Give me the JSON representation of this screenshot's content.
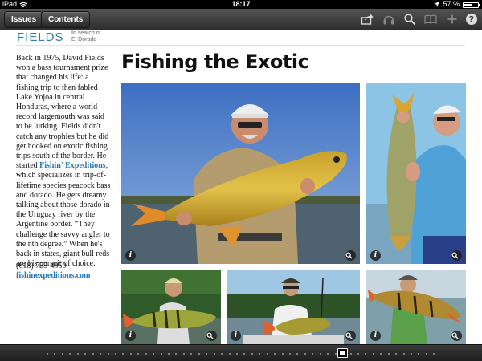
{
  "status_bar": {
    "device": "iPad",
    "time": "18:17",
    "battery": "57 %",
    "battery_level": 0.57
  },
  "toolbar": {
    "issues_label": "Issues",
    "contents_label": "Contents",
    "icons": [
      "share-icon",
      "audio-icon",
      "search-icon",
      "bookmarks-icon",
      "add-icon",
      "help-icon"
    ]
  },
  "header": {
    "brand": "FIELDS",
    "tagline_line1": "In search of",
    "tagline_line2": "El Dorado"
  },
  "article": {
    "title": "Fishing the Exotic",
    "body_before_link": "Back in 1975, David Fields won a bass tournament prize that changed his life: a fishing trip to then fabled Lake Yojoa in central Honduras, where a world record largemouth was said to be lurking. Fields didn't catch any trophies but he did get hooked on exotic fishing trips south of the border. He started ",
    "link_text": "Fishin' Expeditions",
    "body_after_link": ", which specializes in trip-of-lifetime species peacock bass and dorado. He gets dreamy talking about those dorado in the Uruguay river by the Argentine border. “They challenge the savvy angler to the nth degree.” When he's back in states, giant bull reds are his pursuit of choice.",
    "phone": "(618) 755-4950",
    "website": "fishinexpeditions.com"
  },
  "photos": {
    "info_glyph": "i"
  },
  "scrubber": {
    "dot_count": 52,
    "current_page_fraction": 0.76
  }
}
